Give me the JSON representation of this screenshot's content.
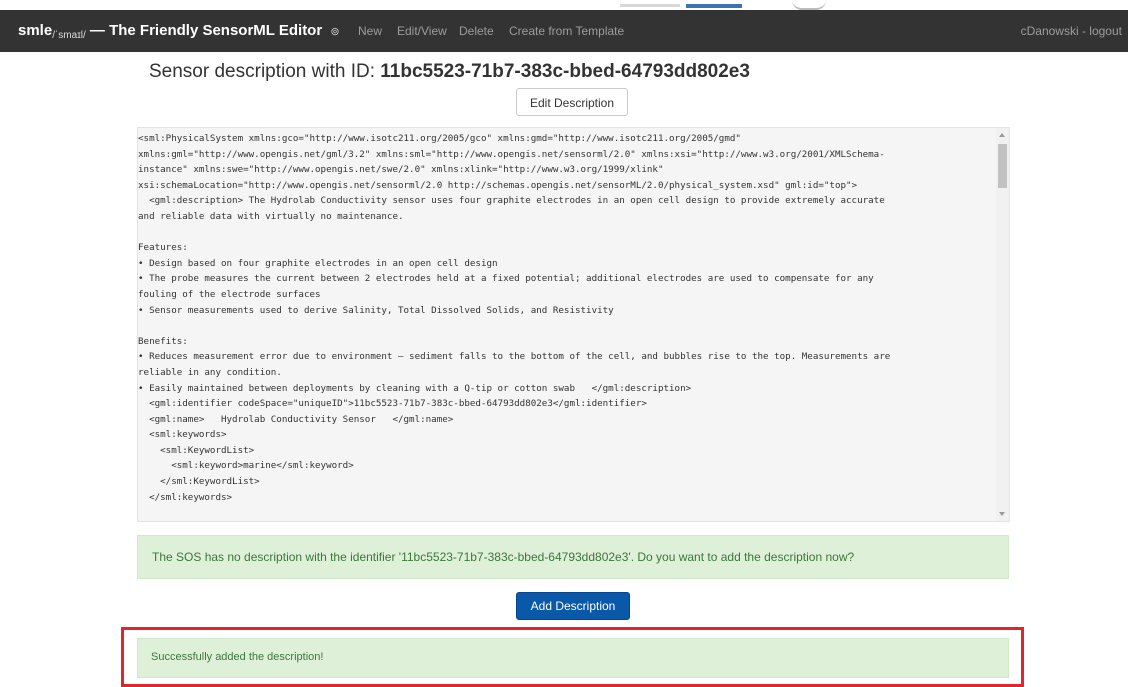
{
  "navbar": {
    "brand_main": "smle",
    "brand_sub": "/ˈsmaɪl/",
    "brand_title": " — The Friendly SensorML Editor ",
    "info_icon": "info-circle-icon",
    "links": [
      "New",
      "Edit/View",
      "Delete",
      "Create from Template"
    ],
    "user_text": "cDanowski - logout"
  },
  "heading": {
    "prefix": "Sensor description with ID: ",
    "id": "11bc5523-71b7-383c-bbed-64793dd802e3"
  },
  "edit_button": "Edit Description",
  "xml_lines": [
    "<sml:PhysicalSystem xmlns:gco=\"http://www.isotc211.org/2005/gco\" xmlns:gmd=\"http://www.isotc211.org/2005/gmd\"",
    "xmlns:gml=\"http://www.opengis.net/gml/3.2\" xmlns:sml=\"http://www.opengis.net/sensorml/2.0\" xmlns:xsi=\"http://www.w3.org/2001/XMLSchema-",
    "instance\" xmlns:swe=\"http://www.opengis.net/swe/2.0\" xmlns:xlink=\"http://www.w3.org/1999/xlink\"",
    "xsi:schemaLocation=\"http://www.opengis.net/sensorml/2.0 http://schemas.opengis.net/sensorML/2.0/physical_system.xsd\" gml:id=\"top\">",
    "  <gml:description> The Hydrolab Conductivity sensor uses four graphite electrodes in an open cell design to provide extremely accurate",
    "and reliable data with virtually no maintenance.",
    "",
    "Features:",
    "• Design based on four graphite electrodes in an open cell design",
    "• The probe measures the current between 2 electrodes held at a fixed potential; additional electrodes are used to compensate for any",
    "fouling of the electrode surfaces",
    "• Sensor measurements used to derive Salinity, Total Dissolved Solids, and Resistivity",
    "",
    "Benefits:",
    "• Reduces measurement error due to environment – sediment falls to the bottom of the cell, and bubbles rise to the top. Measurements are",
    "reliable in any condition.",
    "• Easily maintained between deployments by cleaning with a Q-tip or cotton swab   </gml:description>",
    "  <gml:identifier codeSpace=\"uniqueID\">11bc5523-71b7-383c-bbed-64793dd802e3</gml:identifier>",
    "  <gml:name>   Hydrolab Conductivity Sensor   </gml:name>",
    "  <sml:keywords>",
    "    <sml:KeywordList>",
    "      <sml:keyword>marine</sml:keyword>",
    "    </sml:KeywordList>",
    "  </sml:keywords>"
  ],
  "alert_no_description": "The SOS has no description with the identifier '11bc5523-71b7-383c-bbed-64793dd802e3'. Do you want to add the description now?",
  "add_button": "Add Description",
  "alert_success": "Successfully added the description!",
  "colors": {
    "navbar": "#333333",
    "alert_bg": "#dff0d8",
    "alert_text": "#3c763d",
    "primary": "#0a58a8",
    "highlight": "#e0262b"
  }
}
